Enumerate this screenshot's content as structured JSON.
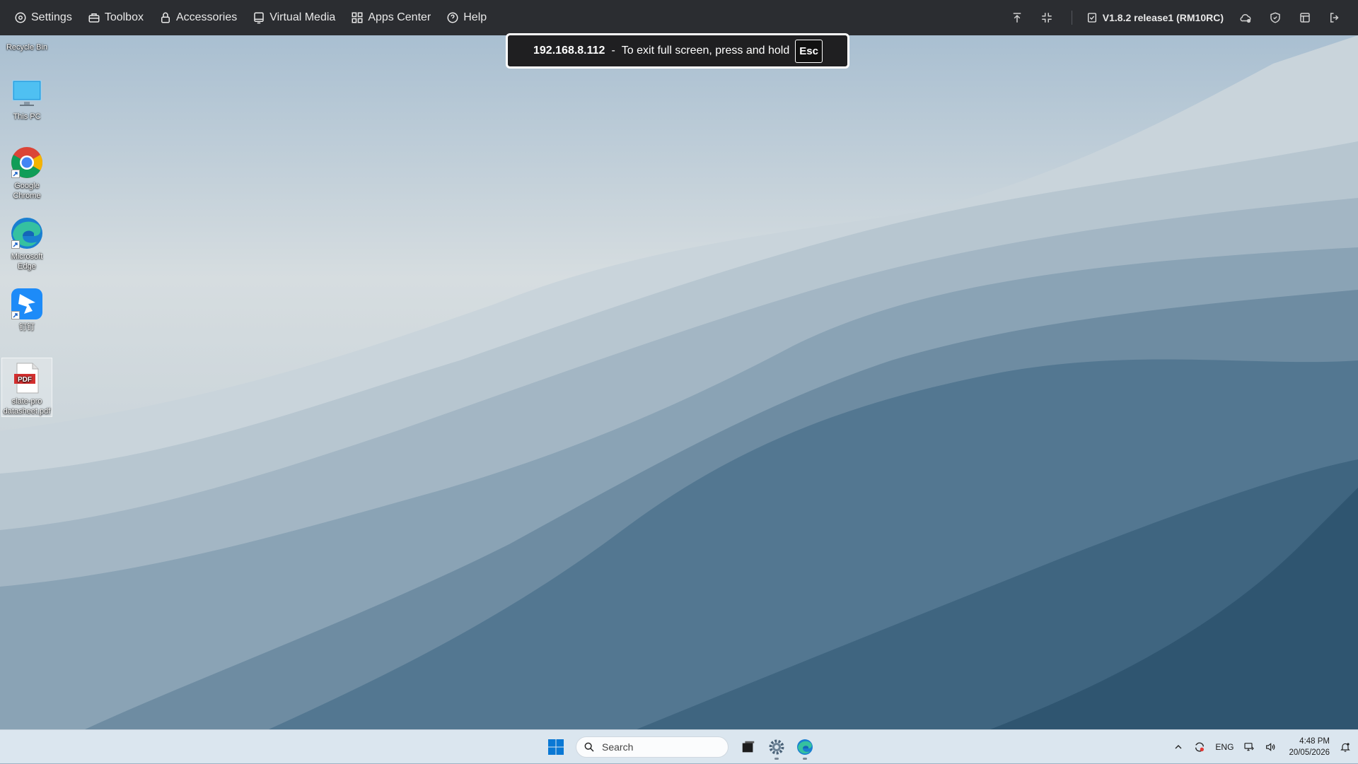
{
  "toolbar": {
    "items": [
      {
        "label": "Settings",
        "icon": "gear-icon"
      },
      {
        "label": "Toolbox",
        "icon": "toolbox-icon"
      },
      {
        "label": "Accessories",
        "icon": "lock-icon"
      },
      {
        "label": "Virtual Media",
        "icon": "monitor-icon"
      },
      {
        "label": "Apps Center",
        "icon": "grid-icon"
      },
      {
        "label": "Help",
        "icon": "help-icon"
      }
    ],
    "version": "V1.8.2 release1 (RM10RC)",
    "right_icons": [
      "pin-top-icon",
      "exit-fullscreen-icon",
      "cloud-icon",
      "shield-icon",
      "window-icon",
      "logout-icon"
    ]
  },
  "fullscreen_notice": {
    "ip": "192.168.8.112",
    "dash": "-",
    "message": "To exit full screen, press and hold",
    "key": "Esc"
  },
  "desktop": {
    "icons": [
      {
        "label": "Recycle Bin",
        "icon": "recycle-bin-icon"
      },
      {
        "label": "This PC",
        "icon": "this-pc-icon"
      },
      {
        "label": "Google Chrome",
        "icon": "chrome-icon"
      },
      {
        "label": "Microsoft Edge",
        "icon": "edge-icon"
      },
      {
        "label": "钉钉",
        "icon": "dingtalk-icon"
      },
      {
        "label": "slate-pro datasheet.pdf",
        "icon": "pdf-icon"
      }
    ]
  },
  "taskbar": {
    "search_placeholder": "Search",
    "tray": {
      "lang": "ENG",
      "time": "4:48 PM",
      "date": "20/05/2026"
    }
  },
  "colors": {
    "toolbar_bg": "#2b2d31",
    "taskbar_bg": "#dbe6ef",
    "notice_bg": "#1f1f21"
  }
}
